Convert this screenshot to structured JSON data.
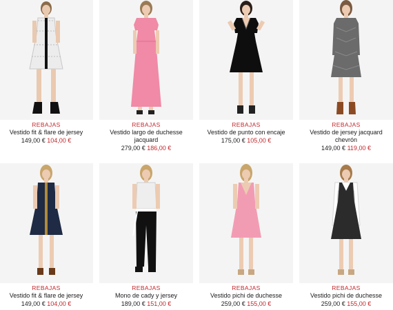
{
  "colors": {
    "sale": "#c0282d",
    "text": "#1a1a1a",
    "photo_bg": "#f3f3f3"
  },
  "products": [
    {
      "badge": "REBAJAS",
      "name": "Vestido fit & flare de jersey",
      "old_price": "149,00 €",
      "new_price": "104,00 €",
      "icon": "dress-tweed-icon"
    },
    {
      "badge": "REBAJAS",
      "name": "Vestido largo de duchesse jacquard",
      "old_price": "279,00 €",
      "new_price": "186,00 €",
      "icon": "dress-long-pink-icon"
    },
    {
      "badge": "REBAJAS",
      "name": "Vestido de punto con encaje",
      "old_price": "175,00 €",
      "new_price": "105,00 €",
      "icon": "dress-black-lace-icon"
    },
    {
      "badge": "REBAJAS",
      "name": "Vestido de jersey jacquard chevrón",
      "old_price": "149,00 €",
      "new_price": "119,00 €",
      "icon": "dress-grey-chevron-icon"
    },
    {
      "badge": "REBAJAS",
      "name": "Vestido fit & flare de jersey",
      "old_price": "149,00 €",
      "new_price": "104,00 €",
      "icon": "dress-navy-icon"
    },
    {
      "badge": "REBAJAS",
      "name": "Mono de cady y jersey",
      "old_price": "189,00 €",
      "new_price": "151,00 €",
      "icon": "jumpsuit-icon"
    },
    {
      "badge": "REBAJAS",
      "name": "Vestido pichi de duchesse",
      "old_price": "259,00 €",
      "new_price": "155,00 €",
      "icon": "dress-pink-pinafore-icon"
    },
    {
      "badge": "REBAJAS",
      "name": "Vestido pichi de duchesse",
      "old_price": "259,00 €",
      "new_price": "155,00 €",
      "icon": "dress-black-pinafore-icon"
    }
  ]
}
